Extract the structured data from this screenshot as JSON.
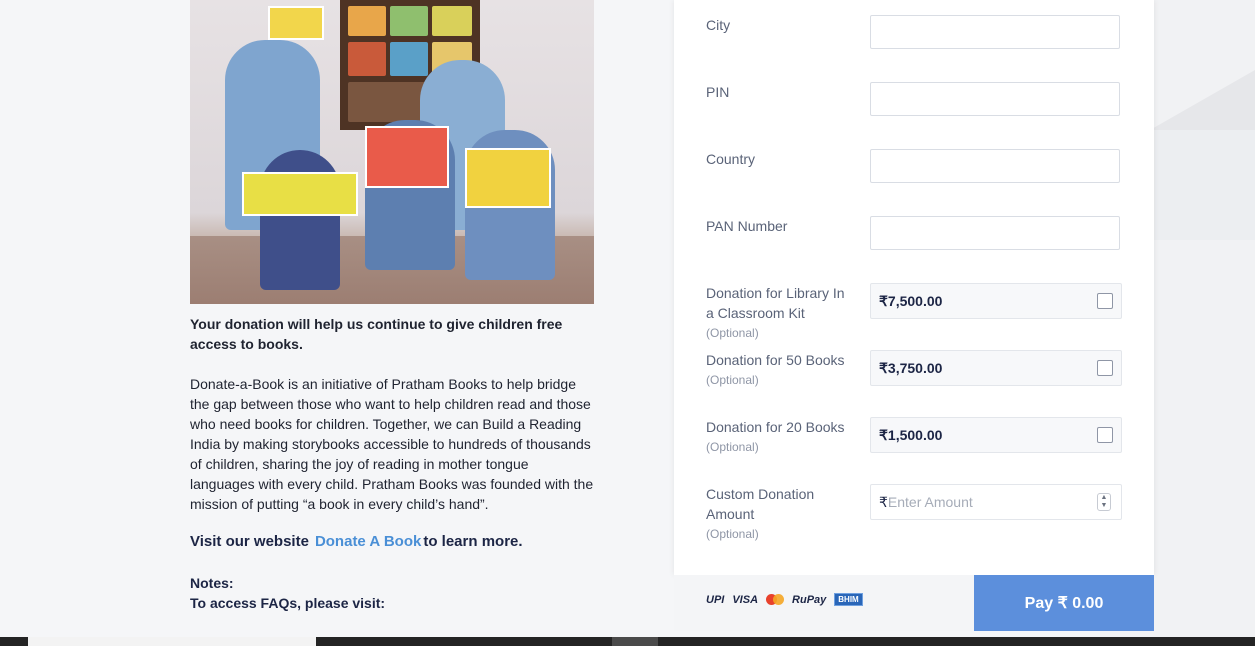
{
  "left": {
    "lead": "Your donation will help us continue to give children free access to books.",
    "paragraph": "Donate-a-Book is an initiative of Pratham Books to help bridge the gap between those who want to help children read and those who need books for children. Together, we can Build a Reading India by making storybooks accessible to hundreds of thousands of children, sharing the joy of reading in mother tongue languages with every child. Pratham Books was founded with the mission of putting “a book in every child’s hand”.",
    "visit_prefix": "Visit our website",
    "visit_link": "Donate A Book",
    "visit_suffix": "to learn more.",
    "notes_title": "Notes:",
    "notes_line": "To access FAQs, please visit:"
  },
  "form": {
    "city_label": "City",
    "pin_label": "PIN",
    "country_label": "Country",
    "pan_label": "PAN Number",
    "optional": "(Optional)",
    "donations": [
      {
        "label": "Donation for Library In a Classroom Kit",
        "amount": "₹7,500.00"
      },
      {
        "label": "Donation for 50 Books",
        "amount": "₹3,750.00"
      },
      {
        "label": "Donation for 20 Books",
        "amount": "₹1,500.00"
      }
    ],
    "custom_label": "Custom Donation Amount",
    "custom_currency": "₹",
    "custom_placeholder": "Enter Amount"
  },
  "footer": {
    "upi": "UPI",
    "visa": "VISA",
    "rupay": "RuPay",
    "bharat": "BHIM",
    "pay_label": "Pay",
    "pay_amount": "₹ 0.00"
  },
  "colors": {
    "accent": "#5c8fdc",
    "link": "#4a8fd6"
  }
}
